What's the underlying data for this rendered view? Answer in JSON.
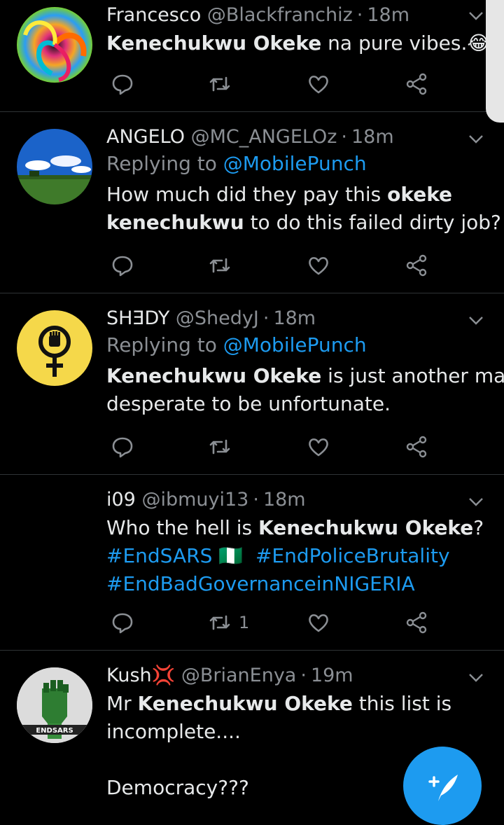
{
  "colors": {
    "background": "#000000",
    "accent": "#1d9bf0",
    "muted": "#8b8f94",
    "text": "#e7e9ea"
  },
  "tweets": [
    {
      "name": "Francesco",
      "handle": "@Blackfranchiz",
      "time": "18m",
      "replying": null,
      "body": [
        [
          {
            "t": "Kenechukwu Okeke",
            "b": true
          },
          {
            "t": " na pure vibes.😂"
          }
        ]
      ],
      "retweets": ""
    },
    {
      "name": "ANGELO",
      "handle": "@MC_ANGELOz",
      "time": "18m",
      "replying": {
        "prefix": "Replying to ",
        "to": "@MobilePunch"
      },
      "body": [
        [
          {
            "t": "How much did they pay this "
          },
          {
            "t": "okeke",
            "b": true
          }
        ],
        [
          {
            "t": "kenechukwu",
            "b": true
          },
          {
            "t": " to do this failed dirty job?"
          }
        ]
      ],
      "retweets": ""
    },
    {
      "name": "SHƎDY",
      "handle": "@ShedyJ",
      "time": "18m",
      "replying": {
        "prefix": "Replying to ",
        "to": "@MobilePunch"
      },
      "body": [
        [
          {
            "t": "Kenechukwu Okeke",
            "b": true
          },
          {
            "t": " is just another man"
          }
        ],
        [
          {
            "t": "desperate to be unfortunate."
          }
        ]
      ],
      "retweets": ""
    },
    {
      "name": "i09",
      "handle": "@ibmuyi13",
      "time": "18m",
      "replying": null,
      "body": [
        [
          {
            "t": "Who the hell is "
          },
          {
            "t": "Kenechukwu Okeke",
            "b": true
          },
          {
            "t": "?"
          }
        ],
        [
          {
            "t": "#EndSARS",
            "tag": true
          },
          {
            "t": " 🇳🇬  "
          },
          {
            "t": "#EndPoliceBrutality",
            "tag": true
          }
        ],
        [
          {
            "t": "#EndBadGovernanceinNIGERIA",
            "tag": true
          }
        ]
      ],
      "retweets": "1"
    },
    {
      "name": "Kush💢",
      "handle": "@BrianEnya",
      "time": "19m",
      "replying": null,
      "body": [
        [
          {
            "t": "Mr "
          },
          {
            "t": "Kenechukwu Okeke",
            "b": true
          },
          {
            "t": " this list is"
          }
        ],
        [
          {
            "t": "incomplete...."
          }
        ],
        [
          {
            "t": " "
          }
        ],
        [
          {
            "t": "Democracy???"
          }
        ]
      ],
      "retweets": "",
      "avatar_text": "ENDSARS"
    }
  ],
  "icons": {
    "reply": "reply-icon",
    "retweet": "retweet-icon",
    "like": "like-icon",
    "share": "share-icon",
    "caret": "chevron-down-icon",
    "compose": "compose-tweet-icon"
  }
}
